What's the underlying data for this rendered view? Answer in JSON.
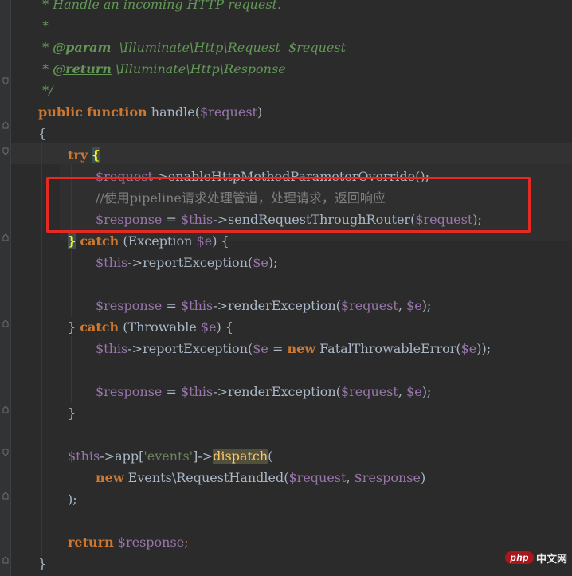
{
  "editor": {
    "colors": {
      "background": "#2b2b2b",
      "keyword": "#cc7832",
      "variable": "#9876aa",
      "function": "#ffc66d",
      "doc_comment": "#629755",
      "line_comment": "#808080",
      "string": "#6a8759",
      "highlight_box": "#e52a24"
    },
    "lines": {
      "l1_text": " * Handle an incoming HTTP request.",
      "l2_text": " *",
      "l3_star": " * ",
      "l3_tag": "@param",
      "l3_rest": "  \\Illuminate\\Http\\Request  $request",
      "l4_star": " * ",
      "l4_tag": "@return",
      "l4_rest": " \\Illuminate\\Http\\Response",
      "l5_text": " */",
      "l6_public": "public",
      "l6_function": "function",
      "l6_name": "handle",
      "l6_paren_open": "(",
      "l6_param": "$request",
      "l6_paren_close": ")",
      "l7_brace": "{",
      "l8_try": "try",
      "l8_brace": "{",
      "l9_var": "$request",
      "l9_arrow": "->",
      "l9_method": "enableHttpMethodParameterOverride",
      "l9_tail": "();",
      "l10_comment": "//使用pipeline请求处理管道，处理请求，返回响应",
      "l11_var": "$response",
      "l11_eq": " = ",
      "l11_this": "$this",
      "l11_arrow": "->",
      "l11_method": "sendRequestThroughRouter",
      "l11_open": "(",
      "l11_arg": "$request",
      "l11_close": ");",
      "l12_brace": "}",
      "l12_catch": "catch",
      "l12_open": " (Exception ",
      "l12_var": "$e",
      "l12_close": ") {",
      "l13_this": "$this",
      "l13_arrow": "->",
      "l13_method": "reportException",
      "l13_open": "(",
      "l13_arg": "$e",
      "l13_close": ");",
      "l15_var": "$response",
      "l15_eq": " = ",
      "l15_this": "$this",
      "l15_arrow": "->",
      "l15_method": "renderException",
      "l15_open": "(",
      "l15_arg1": "$request",
      "l15_comma": ", ",
      "l15_arg2": "$e",
      "l15_close": ");",
      "l16_brace": "}",
      "l16_catch": "catch",
      "l16_open": " (Throwable ",
      "l16_var": "$e",
      "l16_close": ") {",
      "l17_this": "$this",
      "l17_arrow": "->",
      "l17_method": "reportException",
      "l17_open": "(",
      "l17_arg": "$e",
      "l17_eq": " = ",
      "l17_new": "new",
      "l17_class": " FatalThrowableError(",
      "l17_arg2": "$e",
      "l17_close": "));",
      "l19_var": "$response",
      "l19_eq": " = ",
      "l19_this": "$this",
      "l19_arrow": "->",
      "l19_method": "renderException",
      "l19_open": "(",
      "l19_arg1": "$request",
      "l19_comma": ", ",
      "l19_arg2": "$e",
      "l19_close": ");",
      "l20_brace": "}",
      "l22_this": "$this",
      "l22_arrow": "->",
      "l22_prop": "app",
      "l22_open": "[",
      "l22_str": "'events'",
      "l22_close": "]->",
      "l22_method": "dispatch",
      "l22_paren": "(",
      "l23_new": "new",
      "l23_class": " Events\\RequestHandled(",
      "l23_arg1": "$request",
      "l23_comma": ", ",
      "l23_arg2": "$response",
      "l23_close": ")",
      "l24_close": ");",
      "l26_return": "return",
      "l26_var": " $response",
      "l26_semi": ";",
      "l27_brace": "}"
    }
  },
  "watermark": {
    "logo": "php",
    "text": "中文网"
  }
}
